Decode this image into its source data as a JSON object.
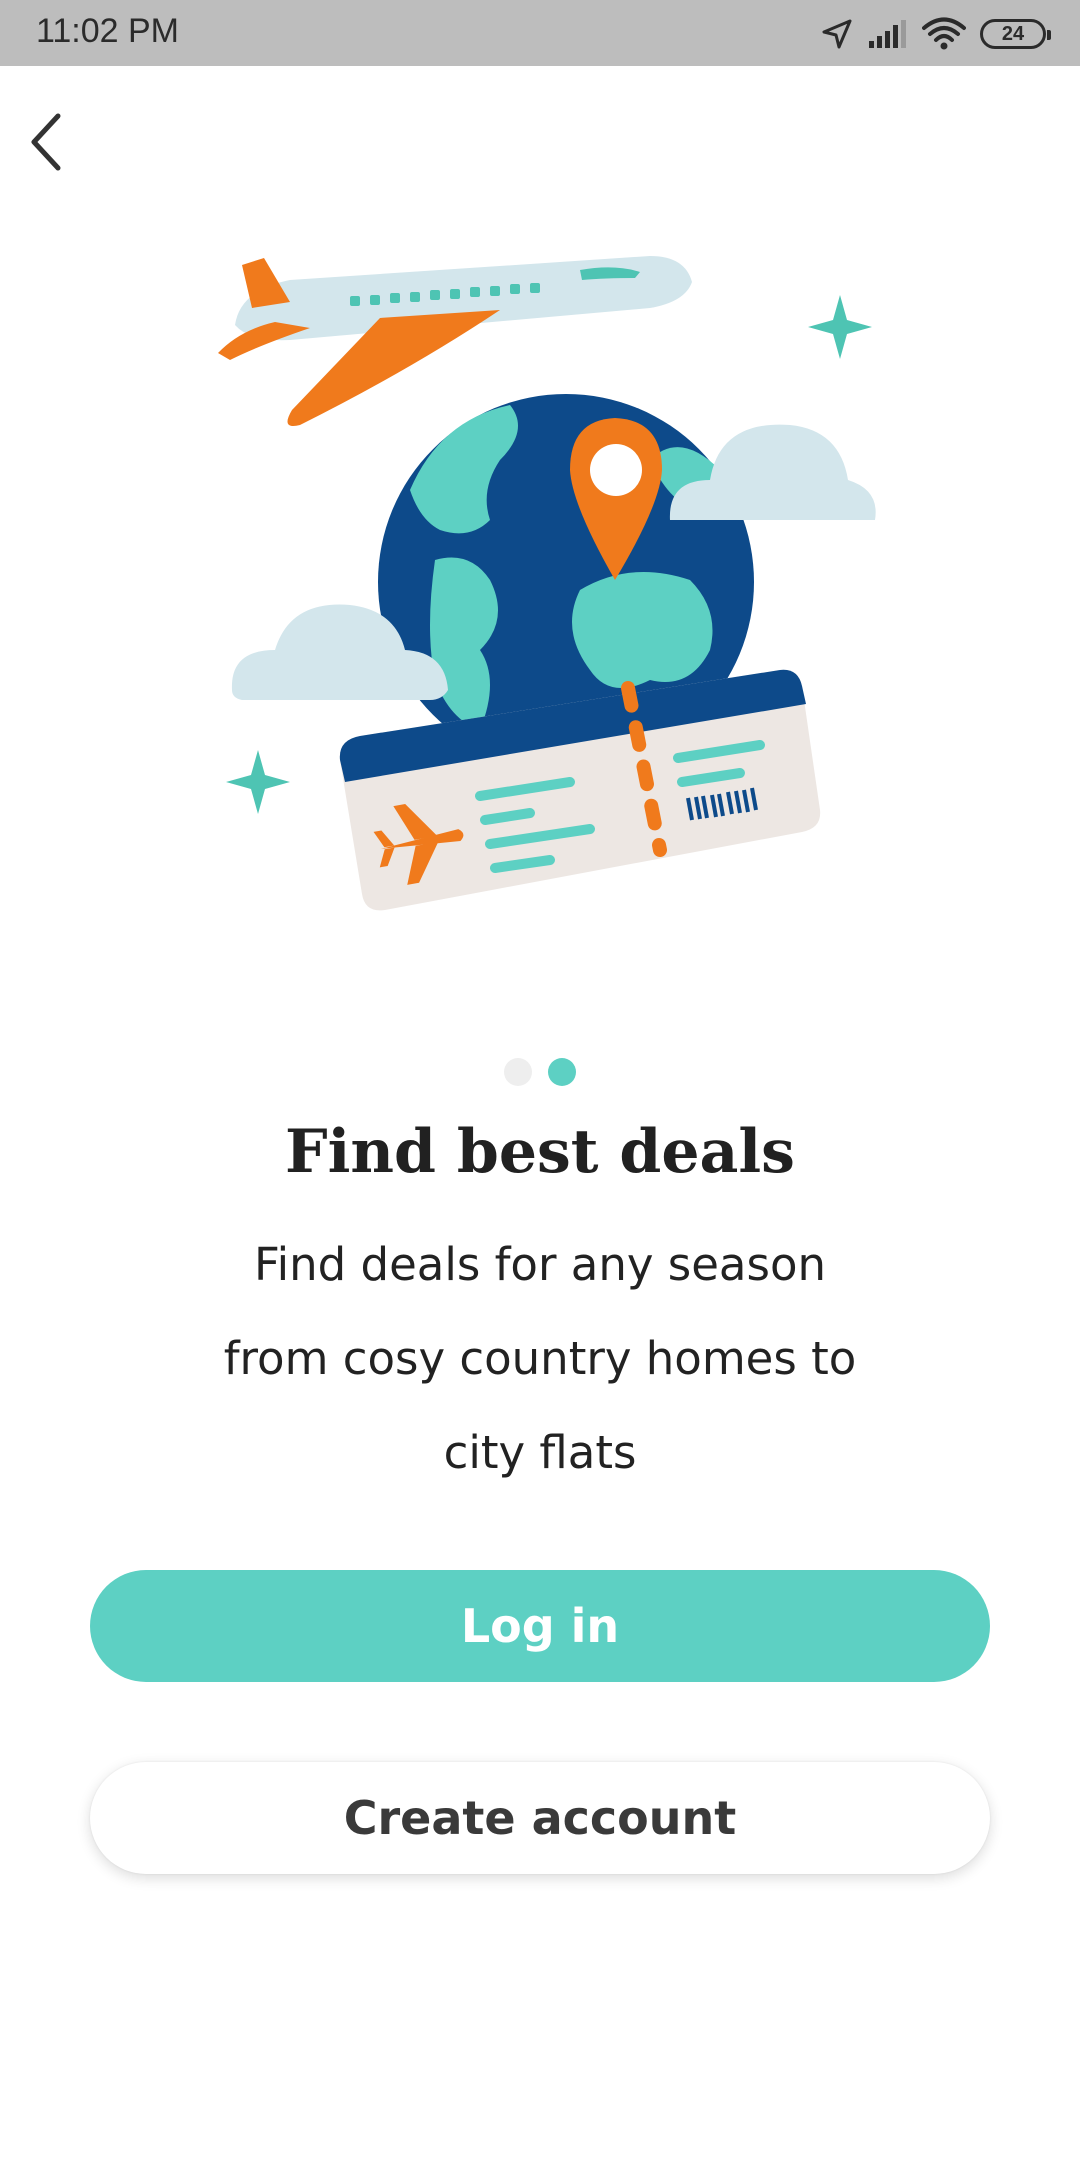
{
  "status_bar": {
    "time": "11:02 PM",
    "battery": "24",
    "icons": [
      "location-arrow-icon",
      "cellular-signal-icon",
      "wifi-icon",
      "battery-icon"
    ]
  },
  "navigation": {
    "back_icon": "chevron-left-icon"
  },
  "illustration": {
    "icons": [
      "airplane-icon",
      "globe-icon",
      "location-pin-icon",
      "boarding-pass-icon",
      "cloud-icon",
      "sparkle-icon"
    ]
  },
  "pager": {
    "total": 2,
    "active_index": 1
  },
  "onboarding": {
    "title": "Find best deals",
    "subtitle_line1": "Find deals for any season",
    "subtitle_line2": "from cosy country homes to",
    "subtitle_line3": "city flats"
  },
  "actions": {
    "login_label": "Log in",
    "create_account_label": "Create account"
  },
  "colors": {
    "accent": "#5dd0c3",
    "orange": "#f07a1c",
    "navy": "#0d4a8a",
    "status_bar": "#bdbdbd"
  }
}
